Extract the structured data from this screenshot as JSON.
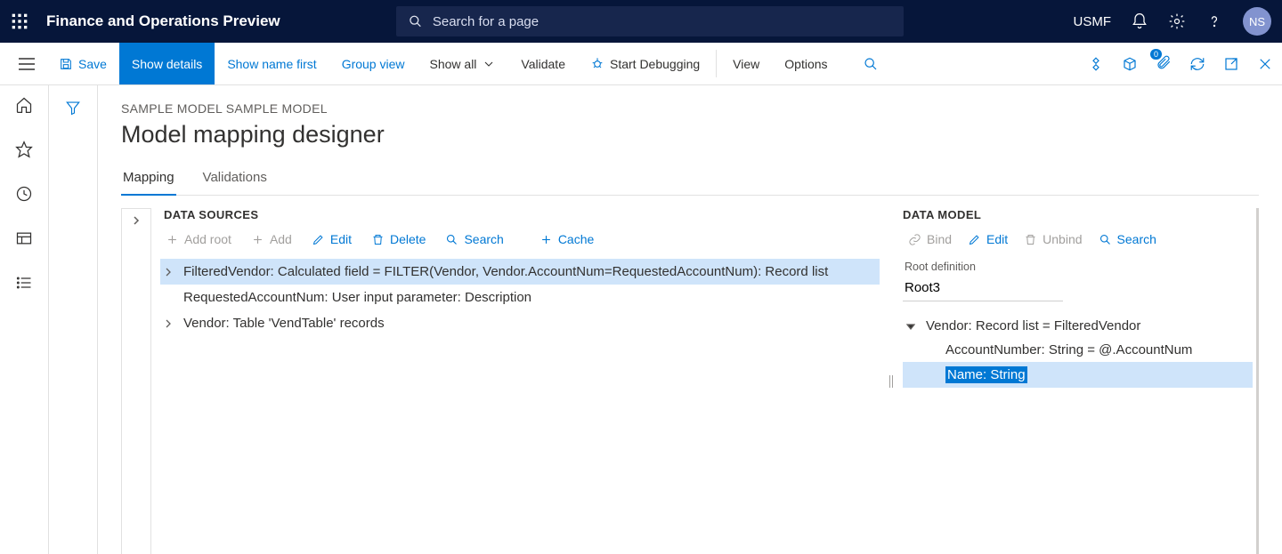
{
  "topbar": {
    "app_title": "Finance and Operations Preview",
    "search_placeholder": "Search for a page",
    "company": "USMF",
    "avatar_initials": "NS"
  },
  "actionbar": {
    "save": "Save",
    "show_details": "Show details",
    "show_name_first": "Show name first",
    "group_view": "Group view",
    "show_all": "Show all",
    "validate": "Validate",
    "start_debugging": "Start Debugging",
    "view": "View",
    "options": "Options",
    "badge_count": "0"
  },
  "page": {
    "breadcrumb": "SAMPLE MODEL SAMPLE MODEL",
    "title": "Model mapping designer",
    "tabs": {
      "mapping": "Mapping",
      "validations": "Validations"
    }
  },
  "datasources": {
    "heading": "DATA SOURCES",
    "toolbar": {
      "add_root": "Add root",
      "add": "Add",
      "edit": "Edit",
      "delete": "Delete",
      "search": "Search",
      "cache": "Cache"
    },
    "items": [
      "FilteredVendor: Calculated field = FILTER(Vendor, Vendor.AccountNum=RequestedAccountNum): Record list",
      "RequestedAccountNum: User input parameter: Description",
      "Vendor: Table 'VendTable' records"
    ]
  },
  "datamodel": {
    "heading": "DATA MODEL",
    "toolbar": {
      "bind": "Bind",
      "edit": "Edit",
      "unbind": "Unbind",
      "search": "Search"
    },
    "root_label": "Root definition",
    "root_value": "Root3",
    "tree": {
      "vendor": "Vendor: Record list = FilteredVendor",
      "account": "AccountNumber: String = @.AccountNum",
      "name": "Name: String"
    }
  }
}
